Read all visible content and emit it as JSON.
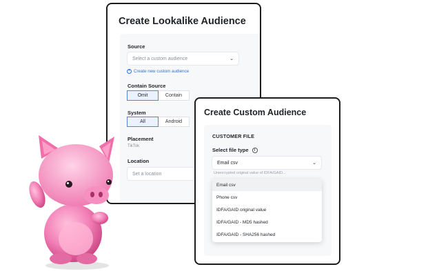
{
  "lookalike": {
    "title": "Create Lookalike Audience",
    "source_label": "Source",
    "source_placeholder": "Select a custom audience",
    "create_link": "Create new custom audience",
    "contain_label": "Contain Source",
    "contain_options": [
      "Omit",
      "Contain"
    ],
    "system_label": "System",
    "system_options": [
      "All",
      "Android"
    ],
    "placement_label": "Placement",
    "placement_value": "TikTok",
    "location_label": "Location",
    "location_placeholder": "Set a location"
  },
  "custom": {
    "title": "Create Custom Audience",
    "section": "CUSTOMER FILE",
    "file_type_label": "Select file type",
    "file_type_value": "Email csv",
    "hint": "Unencrypted original value of IDFA/GAID...",
    "options": [
      "Email csv",
      "Phone csv",
      "IDFA/GAID original value",
      "IDFA/GAID - MD5 hashed",
      "IDFA/GAID - SHA256 hashed"
    ]
  },
  "colors": {
    "accent": "#2f72d6",
    "pig": "#ef7fb4"
  },
  "icons": {
    "dropdown": "chevron-down-icon",
    "add": "plus-circle-icon",
    "info": "info-icon"
  }
}
